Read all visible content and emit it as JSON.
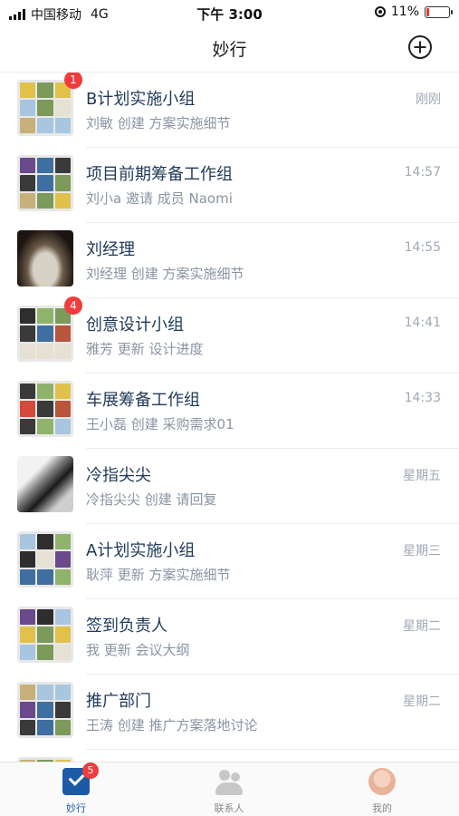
{
  "status_bar": {
    "carrier": "中国移动",
    "network": "4G",
    "time": "下午 3:00",
    "battery": "11%",
    "battery_level": 0.11
  },
  "nav": {
    "title": "妙行"
  },
  "colors": {
    "accent": "#1c5aa8",
    "badge": "#f03c3c",
    "title_text": "#1f3a5a",
    "sub_text": "#8a94a3"
  },
  "chats": [
    {
      "title": "B计划实施小组",
      "subtitle": "刘敏 创建 方案实施细节",
      "time": "刚刚",
      "badge": "1",
      "avatar": "group-avatar"
    },
    {
      "title": "项目前期筹备工作组",
      "subtitle": "刘小a 邀请 成员 Naomi",
      "time": "14:57",
      "badge": "",
      "avatar": "group-avatar"
    },
    {
      "title": "刘经理",
      "subtitle": "刘经理 创建 方案实施细节",
      "time": "14:55",
      "badge": "",
      "avatar": "cat-photo-avatar"
    },
    {
      "title": "创意设计小组",
      "subtitle": "雅芳 更新 设计进度",
      "time": "14:41",
      "badge": "4",
      "avatar": "group-avatar"
    },
    {
      "title": "车展筹备工作组",
      "subtitle": "王小磊 创建 采购需求01",
      "time": "14:33",
      "badge": "",
      "avatar": "group-avatar"
    },
    {
      "title": "冷指尖尖",
      "subtitle": "冷指尖尖 创建 请回复",
      "time": "星期五",
      "badge": "",
      "avatar": "bw-photo-avatar"
    },
    {
      "title": "A计划实施小组",
      "subtitle": "耿萍 更新 方案实施细节",
      "time": "星期三",
      "badge": "",
      "avatar": "group-avatar"
    },
    {
      "title": "签到负责人",
      "subtitle": "我 更新 会议大纲",
      "time": "星期二",
      "badge": "",
      "avatar": "group-avatar"
    },
    {
      "title": "推广部门",
      "subtitle": "王涛 创建 推广方案落地讨论",
      "time": "星期二",
      "badge": "",
      "avatar": "group-avatar"
    }
  ],
  "tabs": [
    {
      "label": "妙行",
      "icon": "check-square-icon",
      "badge": "5",
      "active": true
    },
    {
      "label": "联系人",
      "icon": "contacts-icon",
      "badge": "",
      "active": false
    },
    {
      "label": "我的",
      "icon": "profile-avatar-icon",
      "badge": "",
      "active": false
    }
  ]
}
